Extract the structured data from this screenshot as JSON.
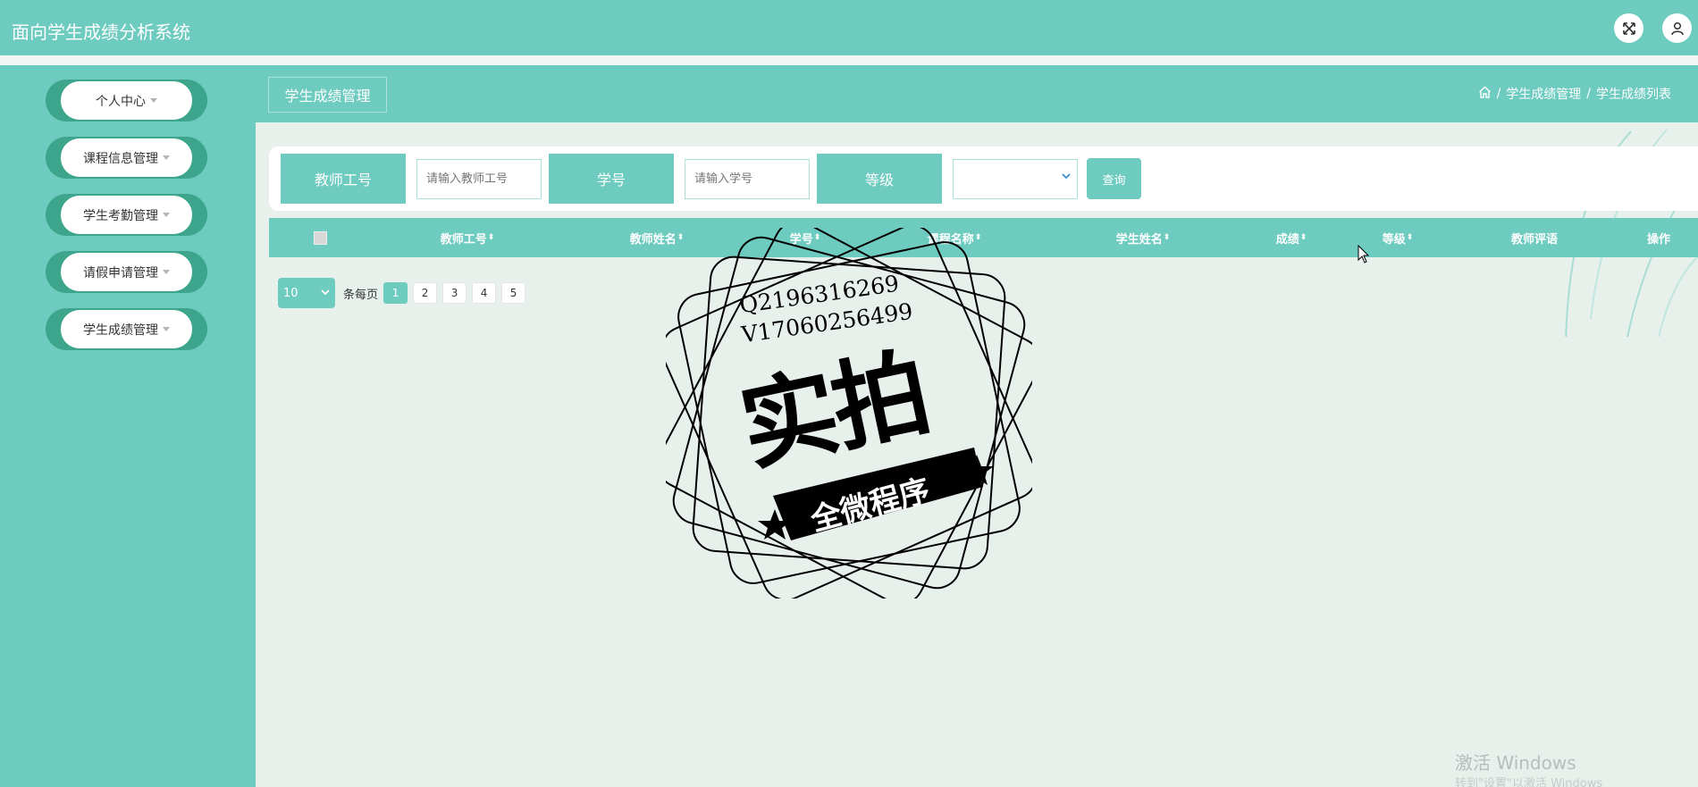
{
  "app": {
    "title": "面向学生成绩分析系统"
  },
  "header": {
    "fullscreen_icon": "fullscreen-icon",
    "user_icon": "user-icon"
  },
  "sidebar": {
    "items": [
      {
        "label": "个人中心"
      },
      {
        "label": "课程信息管理"
      },
      {
        "label": "学生考勤管理"
      },
      {
        "label": "请假申请管理"
      },
      {
        "label": "学生成绩管理"
      }
    ]
  },
  "page": {
    "button_label": "学生成绩管理",
    "breadcrumb": {
      "home_icon": "home-icon",
      "separator": "/",
      "items": [
        "学生成绩管理",
        "学生成绩列表"
      ]
    }
  },
  "search": {
    "teacher_id": {
      "label": "教师工号",
      "placeholder": "请输入教师工号"
    },
    "student_id": {
      "label": "学号",
      "placeholder": "请输入学号"
    },
    "grade": {
      "label": "等级",
      "selected": ""
    },
    "query_button": "查询"
  },
  "table": {
    "columns": [
      {
        "label": "教师工号",
        "sortable": true
      },
      {
        "label": "教师姓名",
        "sortable": true
      },
      {
        "label": "学号",
        "sortable": true
      },
      {
        "label": "课程名称",
        "sortable": true
      },
      {
        "label": "学生姓名",
        "sortable": true
      },
      {
        "label": "成绩",
        "sortable": true
      },
      {
        "label": "等级",
        "sortable": true
      },
      {
        "label": "教师评语",
        "sortable": false
      },
      {
        "label": "操作",
        "sortable": false
      }
    ],
    "rows": []
  },
  "pagination": {
    "page_size": "10",
    "per_page_label": "条每页",
    "pages": [
      "1",
      "2",
      "3",
      "4",
      "5"
    ],
    "current_page": "1"
  },
  "watermark": {
    "line1": "Q2196316269",
    "line2": "V17060256499",
    "big_text": "实拍",
    "ribbon_text": "全微程序"
  },
  "system_overlay": {
    "windows_activation": "激活 Windows",
    "windows_activation_sub": "转到\"设置\"以激活 Windows"
  },
  "colors": {
    "primary": "#6ecbbf",
    "menu_edge": "#3da58c",
    "content_bg": "#e8f0ec"
  }
}
